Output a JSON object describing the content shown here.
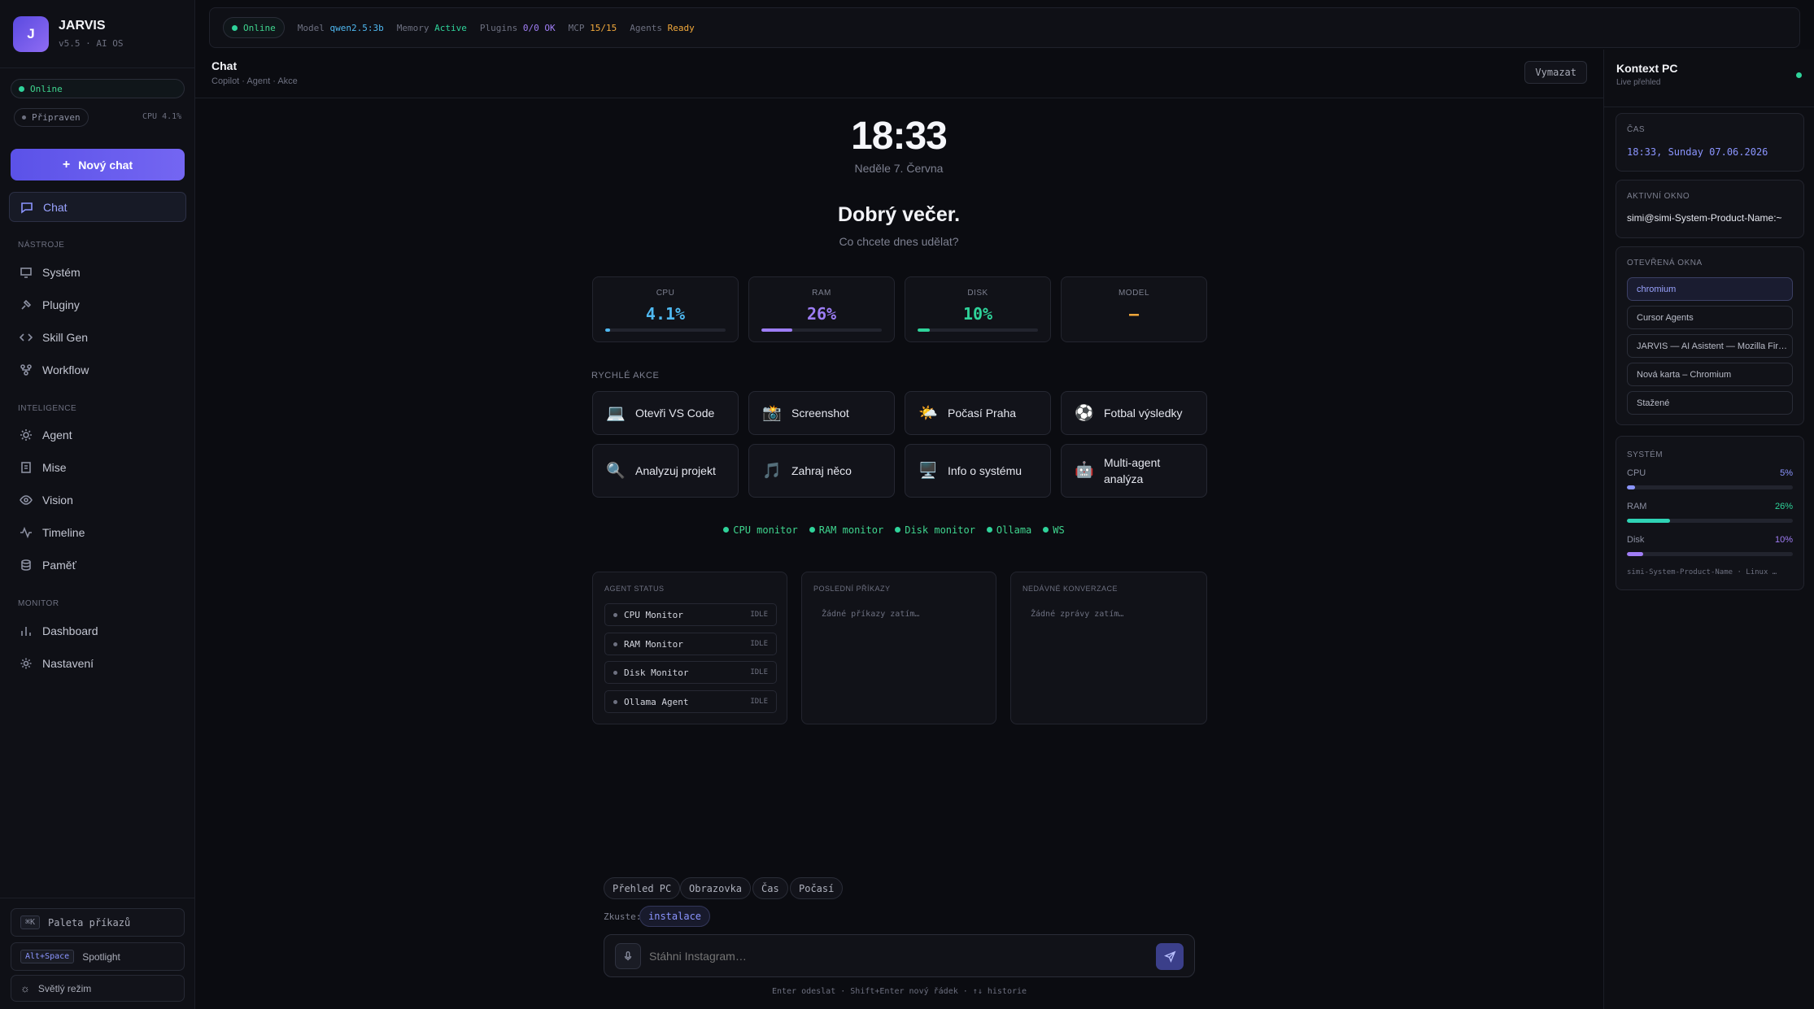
{
  "app": {
    "name": "JARVIS",
    "version": "v5.5 · AI OS"
  },
  "sidebar": {
    "online": "Online",
    "ready": "Připraven",
    "cpu": "CPU 4.1%",
    "new_chat": "Nový chat",
    "chat": "Chat",
    "sections": [
      "NÁSTROJE",
      "INTELIGENCE",
      "MONITOR"
    ],
    "tools": [
      "Systém",
      "Pluginy",
      "Skill Gen",
      "Workflow"
    ],
    "intel": [
      "Agent",
      "Mise",
      "Vision",
      "Timeline",
      "Paměť"
    ],
    "monitor": [
      "Dashboard",
      "Nastavení"
    ],
    "palette_key": "⌘K",
    "palette": "Paleta příkazů",
    "spotlight_key": "Alt+Space",
    "spotlight": "Spotlight",
    "light_mode": "Světlý režim"
  },
  "topbar": {
    "status": "Online",
    "model_label": "Model",
    "model": "qwen2.5:3b",
    "memory_label": "Memory",
    "memory": "Active",
    "plugins_label": "Plugins",
    "plugins": "0/0 OK",
    "mcp_label": "MCP",
    "mcp": "15/15",
    "agents_label": "Agents",
    "agents": "Ready"
  },
  "chat": {
    "title": "Chat",
    "subtitle": "Copilot · Agent · Akce",
    "clear": "Vymazat"
  },
  "main": {
    "time": "18:33",
    "date": "Neděle 7. Června",
    "greeting": "Dobrý večer.",
    "prompt": "Co chcete dnes udělat?",
    "stats": [
      {
        "label": "CPU",
        "value": "4.1%",
        "pct": 4.1,
        "color": "#4fb8f0"
      },
      {
        "label": "RAM",
        "value": "26%",
        "pct": 26,
        "color": "#9d7df5"
      },
      {
        "label": "DISK",
        "value": "10%",
        "pct": 10,
        "color": "#2fd39a"
      },
      {
        "label": "MODEL",
        "value": "—",
        "color": "#f2a93b"
      }
    ],
    "quick_title": "RYCHLÉ AKCE",
    "actions": [
      {
        "icon": "💻",
        "label": "Otevři VS Code"
      },
      {
        "icon": "📸",
        "label": "Screenshot"
      },
      {
        "icon": "🌤️",
        "label": "Počasí Praha"
      },
      {
        "icon": "⚽",
        "label": "Fotbal výsledky"
      },
      {
        "icon": "🔍",
        "label": "Analyzuj projekt"
      },
      {
        "icon": "🎵",
        "label": "Zahraj něco"
      },
      {
        "icon": "🖥️",
        "label": "Info o systému"
      },
      {
        "icon": "🤖",
        "label": "Multi-agent analýza"
      }
    ],
    "monitors": [
      "CPU monitor",
      "RAM monitor",
      "Disk monitor",
      "Ollama",
      "WS"
    ],
    "agent_status_title": "AGENT STATUS",
    "agents": [
      {
        "name": "CPU Monitor",
        "state": "IDLE"
      },
      {
        "name": "RAM Monitor",
        "state": "IDLE"
      },
      {
        "name": "Disk Monitor",
        "state": "IDLE"
      },
      {
        "name": "Ollama Agent",
        "state": "IDLE"
      }
    ],
    "last_cmds_title": "POSLEDNÍ PŘÍKAZY",
    "last_cmds_empty": "Žádné příkazy zatím…",
    "recent_title": "NEDÁVNÉ KONVERZACE",
    "recent_empty": "Žádné zprávy zatím…",
    "chips": [
      "Přehled PC",
      "Obrazovka",
      "Čas",
      "Počasí"
    ],
    "try_label": "Zkuste:",
    "try_chip": "instalace",
    "input_placeholder": "Stáhni Instagram…",
    "hint": "Enter odeslat · Shift+Enter nový řádek · ↑↓ historie"
  },
  "context": {
    "title": "Kontext PC",
    "subtitle": "Live přehled",
    "time_label": "ČAS",
    "time": "18:33, Sunday 07.06.2026",
    "active_label": "AKTIVNÍ OKNO",
    "active": "simi@simi-System-Product-Name:~",
    "windows_label": "OTEVŘENÁ OKNA",
    "windows": [
      "chromium",
      "Cursor Agents",
      "JARVIS — AI Asistent — Mozilla Fir…",
      "Nová karta – Chromium",
      "Stažené"
    ],
    "system_label": "SYSTÉM",
    "cpu_label": "CPU",
    "cpu": "5%",
    "cpu_pct": 5,
    "ram_label": "RAM",
    "ram": "26%",
    "ram_pct": 26,
    "disk_label": "Disk",
    "disk": "10%",
    "disk_pct": 10,
    "host": "simi-System-Product-Name · Linux …"
  }
}
